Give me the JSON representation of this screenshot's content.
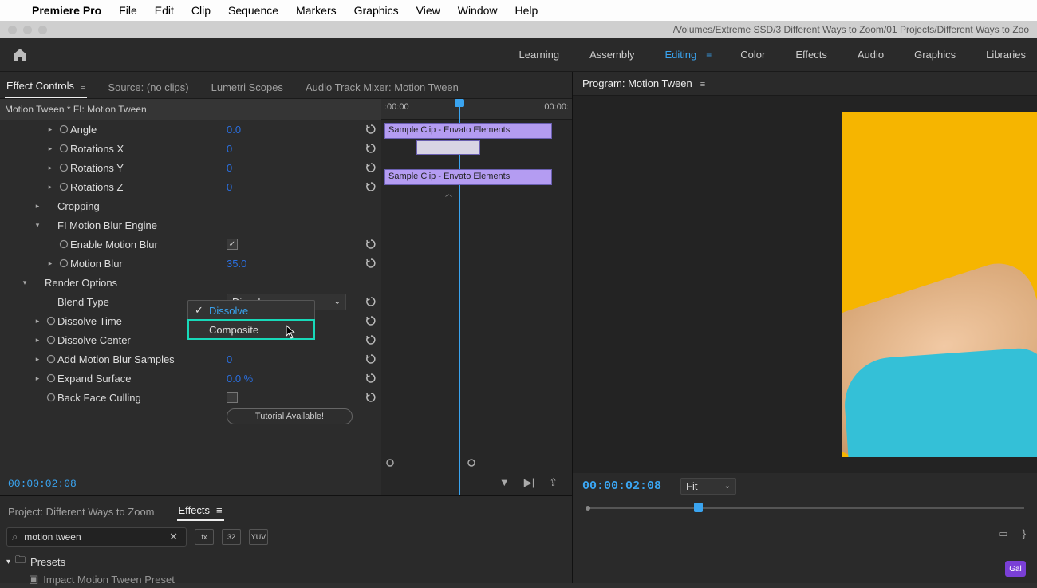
{
  "mac_menu": {
    "app": "Premiere Pro",
    "items": [
      "File",
      "Edit",
      "Clip",
      "Sequence",
      "Markers",
      "Graphics",
      "View",
      "Window",
      "Help"
    ]
  },
  "titlebar_path": "/Volumes/Extreme SSD/3 Different Ways to Zoom/01 Projects/Different Ways to Zoo",
  "workspaces": [
    "Learning",
    "Assembly",
    "Editing",
    "Color",
    "Effects",
    "Audio",
    "Graphics",
    "Libraries"
  ],
  "workspace_active": "Editing",
  "source_tabs": {
    "active": "Effect Controls",
    "items": [
      "Effect Controls",
      "Source: (no clips)",
      "Lumetri Scopes",
      "Audio Track Mixer: Motion Tween"
    ]
  },
  "ec_header": "Motion Tween * FI: Motion Tween",
  "ec_time_labels": {
    "start": ":00:00",
    "end": "00:00:"
  },
  "props": [
    {
      "twist": true,
      "stop": true,
      "label": "Angle",
      "value": "0.0",
      "reset": true,
      "indent": 3
    },
    {
      "twist": true,
      "stop": true,
      "label": "Rotations X",
      "value": "0",
      "reset": true,
      "indent": 3
    },
    {
      "twist": true,
      "stop": true,
      "label": "Rotations Y",
      "value": "0",
      "reset": true,
      "indent": 3
    },
    {
      "twist": true,
      "stop": true,
      "label": "Rotations Z",
      "value": "0",
      "reset": true,
      "indent": 3
    },
    {
      "twist": true,
      "label": "Cropping",
      "indent": 2
    },
    {
      "twist": "open",
      "label": "FI Motion Blur Engine",
      "indent": 2
    },
    {
      "stop": true,
      "label": "Enable Motion Blur",
      "check": true,
      "reset": true,
      "indent": 3
    },
    {
      "twist": true,
      "stop": true,
      "label": "Motion Blur",
      "value": "35.0",
      "reset": true,
      "indent": 3
    },
    {
      "twist": "open",
      "label": "Render Options",
      "indent": 1
    },
    {
      "label": "Blend Type",
      "dropdown": "Dissolve",
      "reset": true,
      "indent": 2
    },
    {
      "twist": true,
      "stop": true,
      "label": "Dissolve Time",
      "reset": true,
      "indent": 2
    },
    {
      "twist": true,
      "stop": true,
      "label": "Dissolve Center",
      "reset": true,
      "indent": 2
    },
    {
      "twist": true,
      "stop": true,
      "label": "Add Motion Blur Samples",
      "value": "0",
      "reset": true,
      "indent": 2
    },
    {
      "twist": true,
      "stop": true,
      "label": "Expand Surface",
      "value": "0.0 %",
      "reset": true,
      "indent": 2
    },
    {
      "stop": true,
      "label": "Back Face Culling",
      "check": false,
      "reset": true,
      "indent": 2
    },
    {
      "button": "Tutorial Available!",
      "indent": 2
    }
  ],
  "blend_popup": {
    "options": [
      "Dissolve",
      "Composite"
    ],
    "selected": "Dissolve",
    "highlight": "Composite"
  },
  "clips": {
    "top": "Sample Clip - Envato Elements",
    "bottom": "Sample Clip - Envato Elements"
  },
  "ec_timecode": "00:00:02:08",
  "project": {
    "tabs": [
      "Project: Different Ways to Zoom",
      "Effects"
    ],
    "active": "Effects",
    "search": "motion tween",
    "chips": [
      "fx",
      "32",
      "YUV"
    ],
    "tree": [
      "Presets",
      "Impact Motion Tween Preset"
    ]
  },
  "program": {
    "title": "Program: Motion Tween",
    "timecode": "00:00:02:08",
    "zoom": "Fit",
    "badge": "Gal"
  }
}
